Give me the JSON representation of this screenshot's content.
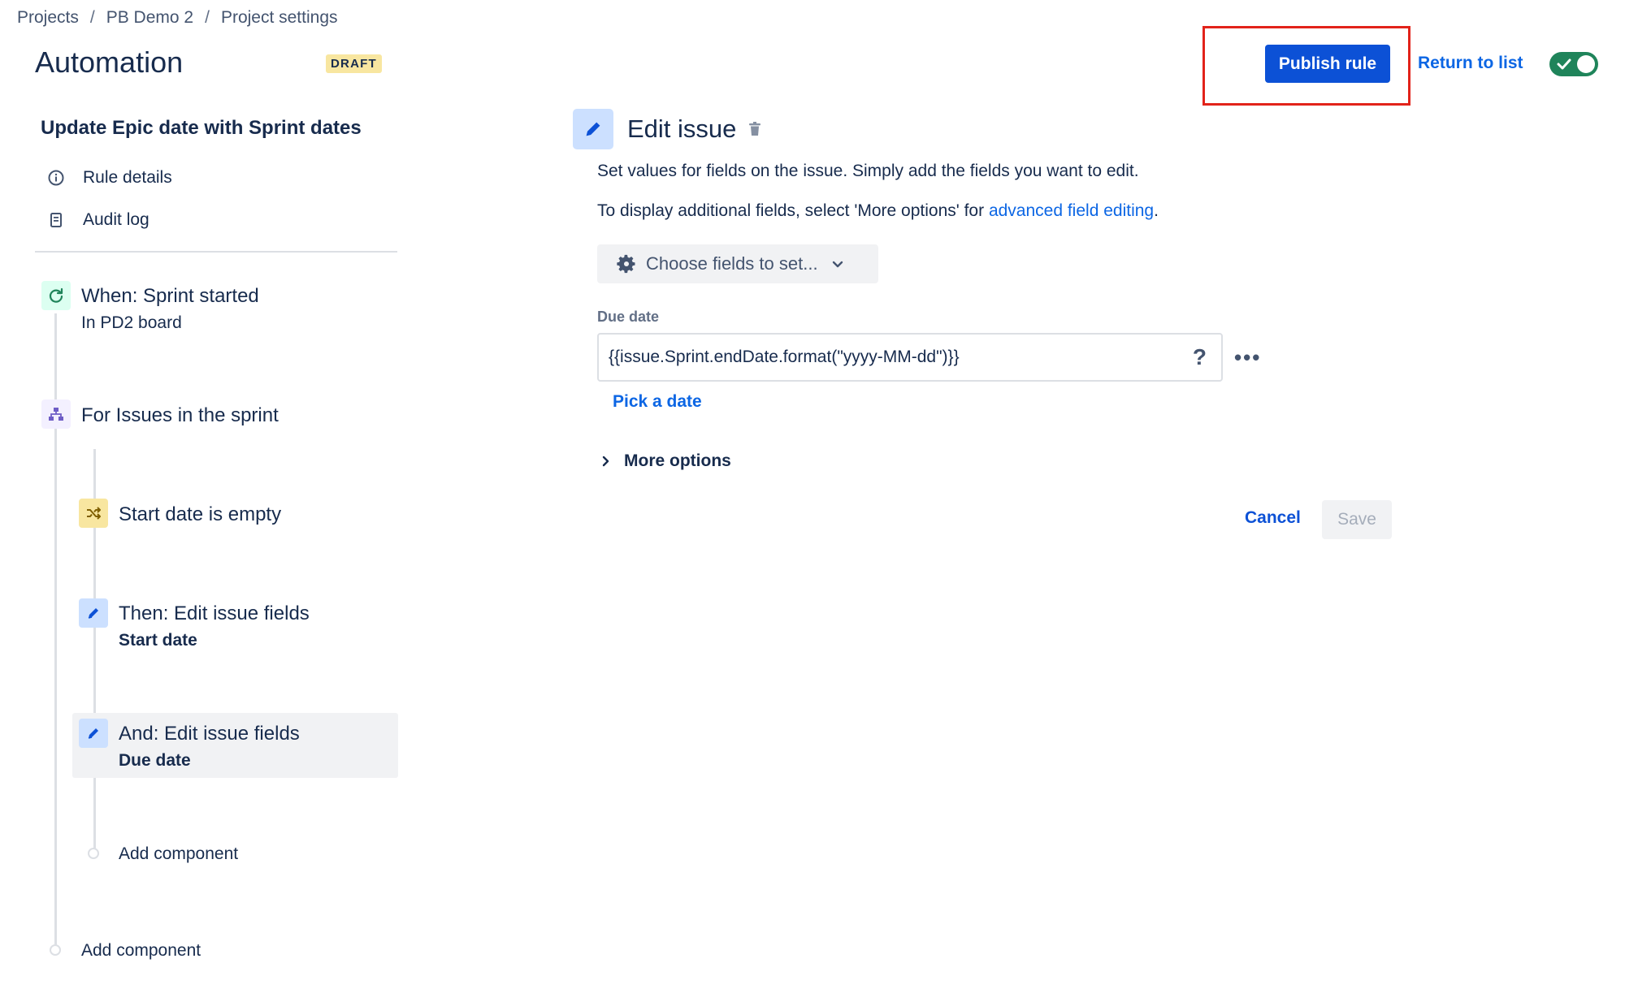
{
  "breadcrumb": [
    "Projects",
    "PB Demo 2",
    "Project settings"
  ],
  "header": {
    "title": "Automation",
    "badge": "DRAFT",
    "publish_label": "Publish rule",
    "return_label": "Return to list",
    "toggle_on": true
  },
  "sidebar": {
    "rule_name": "Update Epic date with Sprint dates",
    "links": [
      {
        "label": "Rule details",
        "icon": "info-icon"
      },
      {
        "label": "Audit log",
        "icon": "document-icon"
      }
    ],
    "components": {
      "trigger": {
        "title": "When: Sprint started",
        "sub": "In PD2 board"
      },
      "branch": {
        "title": "For Issues in the sprint"
      },
      "condition": {
        "title": "Start date is empty"
      },
      "action1": {
        "title": "Then: Edit issue fields",
        "sub": "Start date"
      },
      "action2": {
        "title": "And: Edit issue fields",
        "sub": "Due date"
      },
      "add_inner": "Add component",
      "add_outer": "Add component"
    }
  },
  "panel": {
    "title": "Edit issue",
    "description": "Set values for fields on the issue. Simply add the fields you want to edit.",
    "additional_prefix": "To display additional fields, select 'More options' for ",
    "additional_link": "advanced field editing",
    "additional_suffix": ".",
    "choose_fields": "Choose fields to set...",
    "field_label": "Due date",
    "field_value": "{{issue.Sprint.endDate.format(\"yyyy-MM-dd\")}}",
    "help_glyph": "?",
    "more_dots": "•••",
    "pick_date": "Pick a date",
    "more_options": "More options",
    "cancel": "Cancel",
    "save": "Save"
  },
  "colors": {
    "primary": "#0c51d6",
    "link": "#0c66e4",
    "highlight": "#e2231a",
    "toggle": "#1f845a",
    "draft": "#f8e6a0"
  }
}
